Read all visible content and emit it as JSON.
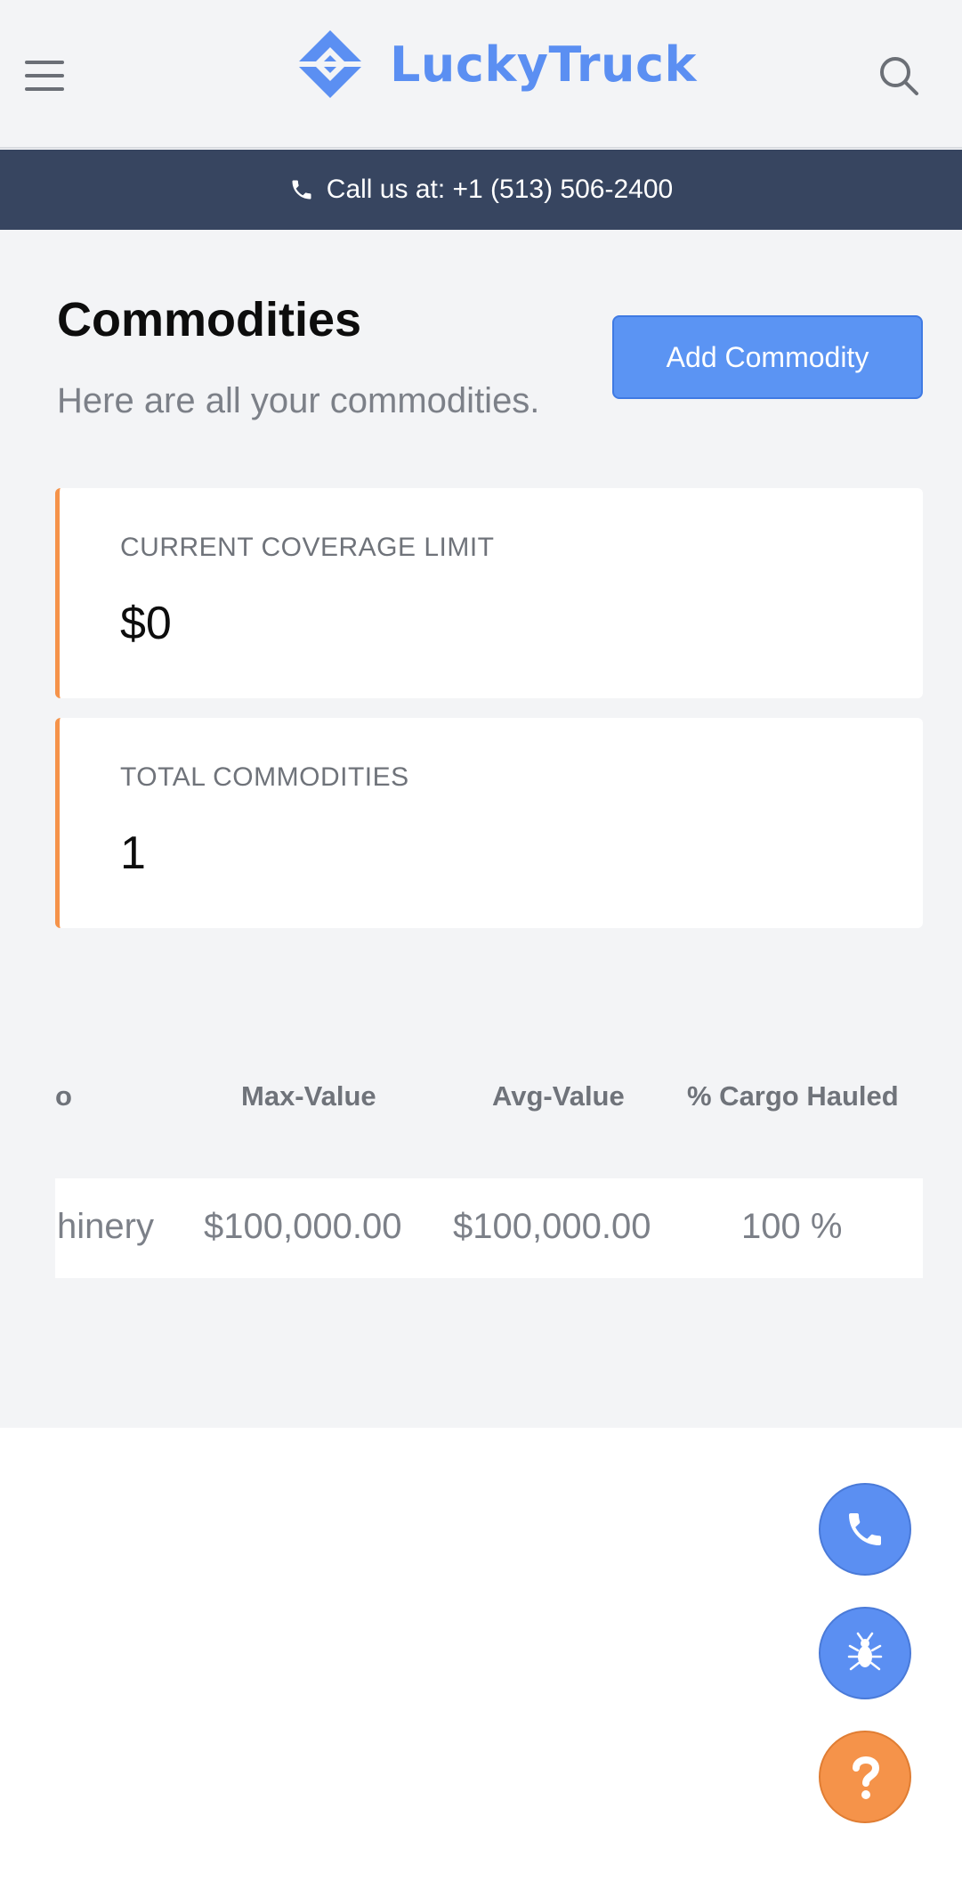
{
  "header": {
    "brand": "LuckyTruck",
    "colors": {
      "brand": "#5b8ff2",
      "topbar": "#f3f4f6"
    },
    "icons": {
      "menu": "hamburger-menu-icon",
      "search": "search-icon",
      "logo": "luckytruck-logo-icon"
    }
  },
  "callbar": {
    "text": "Call us at: +1 (513) 506-2400",
    "icon": "phone-icon",
    "color": "#374560"
  },
  "page": {
    "title": "Commodities",
    "subtitle": "Here are all your commodities.",
    "add_button": "Add Commodity"
  },
  "stats": [
    {
      "label": "CURRENT COVERAGE LIMIT",
      "value": "$0"
    },
    {
      "label": "TOTAL COMMODITIES",
      "value": "1"
    }
  ],
  "accent_color": "#f5934a",
  "table": {
    "headers": [
      "o",
      "Max-Value",
      "Avg-Value",
      "% Cargo Hauled"
    ],
    "rows": [
      [
        "hinery",
        "$100,000.00",
        "$100,000.00",
        "100 %"
      ]
    ]
  },
  "fabs": [
    {
      "icon": "phone-icon",
      "color": "#5b8ff2"
    },
    {
      "icon": "bug-icon",
      "color": "#5b8ff2"
    },
    {
      "icon": "help-icon",
      "color": "#f5934a"
    }
  ]
}
